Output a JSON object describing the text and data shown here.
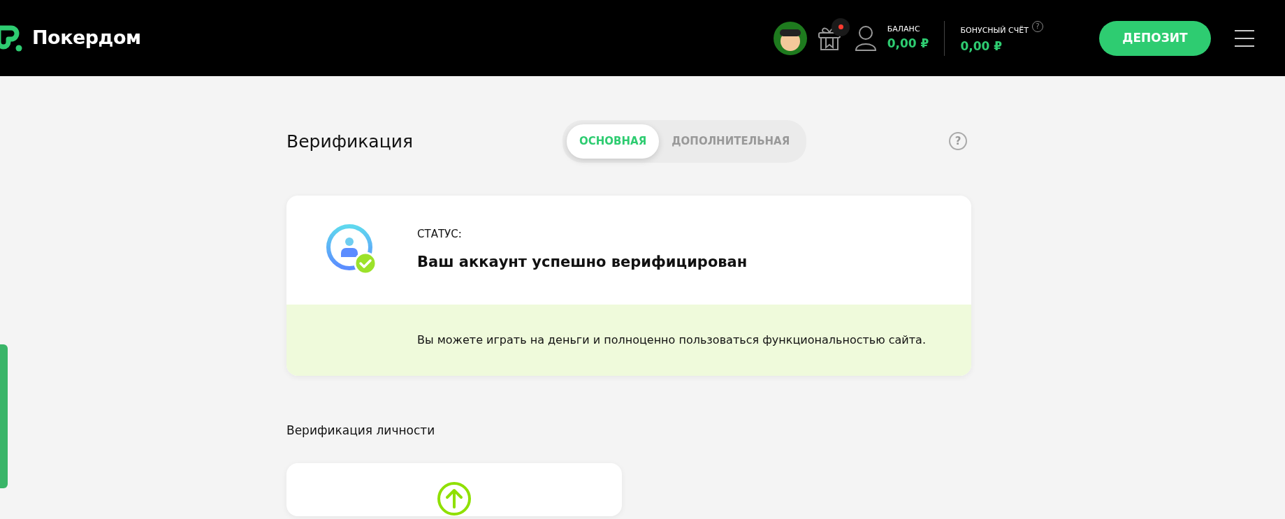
{
  "header": {
    "logo_text": "Покердом",
    "gift_has_notification": true,
    "balance": {
      "label": "БАЛАНС",
      "value": "0,00 ₽"
    },
    "bonus": {
      "label": "БОНУСНЫЙ СЧЁТ",
      "help": "?",
      "value": "0,00 ₽"
    },
    "deposit_button": "ДЕПОЗИТ"
  },
  "page": {
    "title": "Верификация",
    "help": "?",
    "tabs": [
      {
        "label": "ОСНОВНАЯ",
        "selected": true
      },
      {
        "label": "ДОПОЛНИТЕЛЬНАЯ",
        "selected": false
      }
    ]
  },
  "status_card": {
    "label": "СТАТУС:",
    "status": "Ваш аккаунт успешно верифицирован",
    "verified": true,
    "message": "Вы можете играть на деньги и полноценно пользоваться функциональностью сайта."
  },
  "section_title": "Верификация личности"
}
